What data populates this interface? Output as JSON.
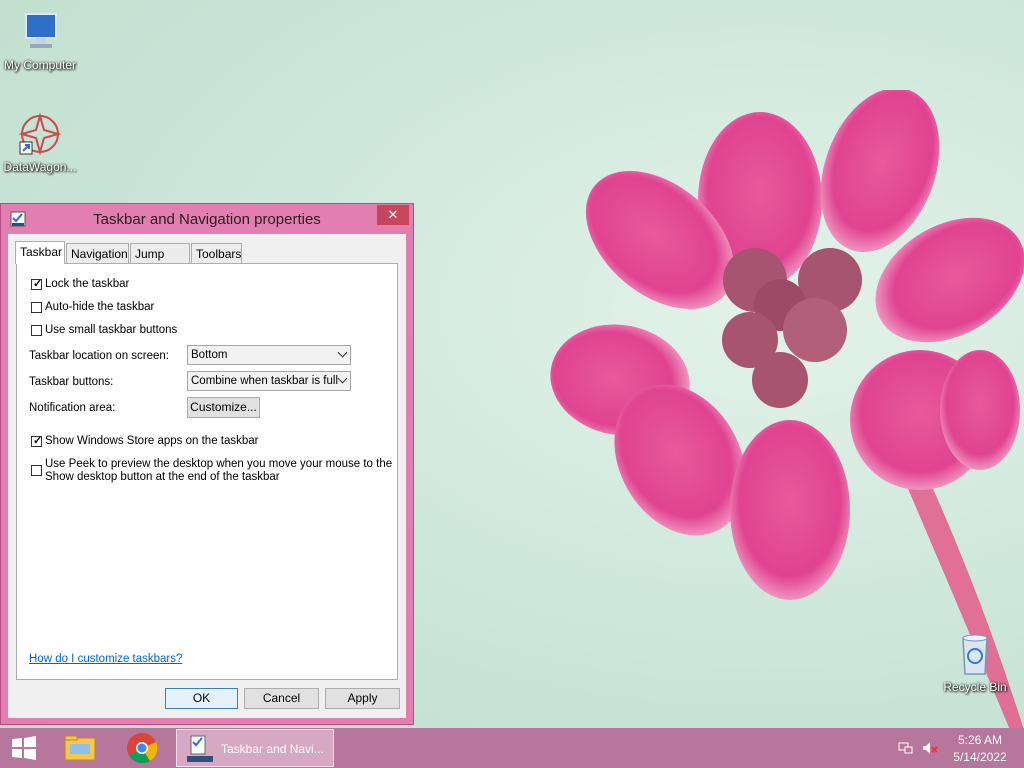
{
  "desktop": {
    "icons": [
      {
        "label": "My Computer"
      },
      {
        "label": "DataWagon..."
      },
      {
        "label": "Recycle Bin"
      }
    ]
  },
  "dialog": {
    "title": "Taskbar and Navigation properties",
    "close_label": "✕",
    "tabs": [
      {
        "label": "Taskbar",
        "active": true
      },
      {
        "label": "Navigation"
      },
      {
        "label": "Jump Lists"
      },
      {
        "label": "Toolbars"
      }
    ],
    "checkboxes": {
      "lock": {
        "label": "Lock the taskbar",
        "checked": true
      },
      "autohide": {
        "label": "Auto-hide the taskbar",
        "checked": false
      },
      "small": {
        "label": "Use small taskbar buttons",
        "checked": false
      },
      "store": {
        "label": "Show Windows Store apps on the taskbar",
        "checked": true
      },
      "peek": {
        "line1": "Use Peek to preview the desktop when you move your mouse to the",
        "line2": "Show desktop button at the end of the taskbar",
        "checked": false
      }
    },
    "location": {
      "label": "Taskbar location on screen:",
      "value": "Bottom"
    },
    "buttons": {
      "label": "Taskbar buttons:",
      "value": "Combine when taskbar is full"
    },
    "notification": {
      "label": "Notification area:",
      "button": "Customize..."
    },
    "help_link": "How do I customize taskbars?",
    "ok": "OK",
    "cancel": "Cancel",
    "apply": "Apply"
  },
  "taskbar": {
    "window_label": "Taskbar and Navi...",
    "time": "5:26 AM",
    "date": "5/14/2022"
  },
  "colors": {
    "taskbar": "#b7769c",
    "dialog_frame": "#e27fb0",
    "close_button": "#c7475a",
    "link": "#0066cc"
  }
}
